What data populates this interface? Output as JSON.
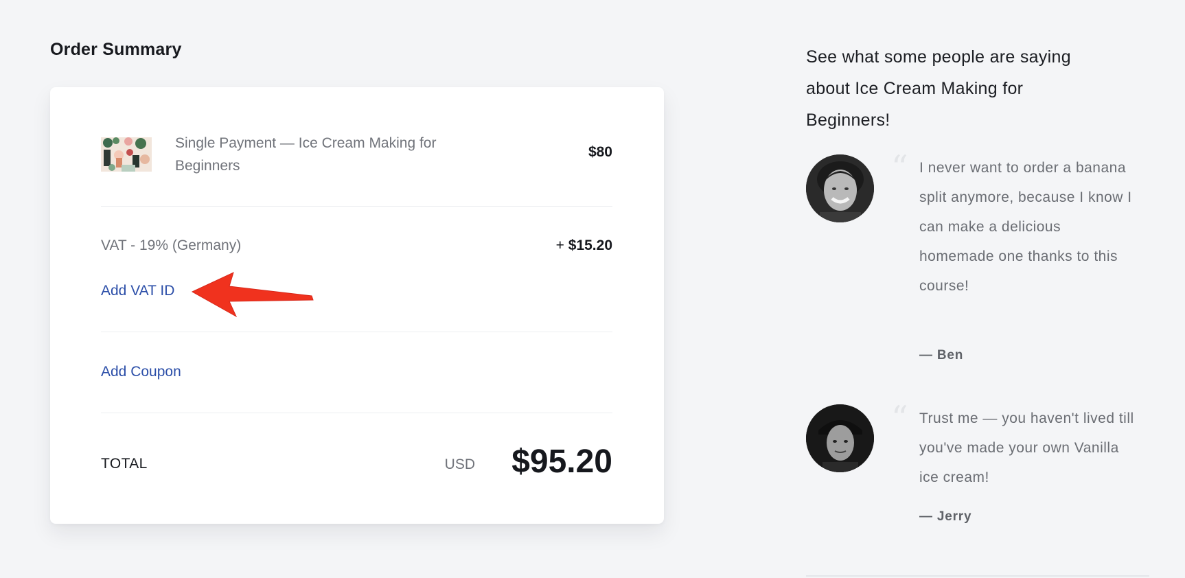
{
  "order_summary": {
    "title": "Order Summary",
    "product": {
      "name": "Single Payment — Ice Cream Making for Beginners",
      "price": "$80",
      "thumbnail_icon": "course-thumbnail-image"
    },
    "vat": {
      "label": "VAT - 19% (Germany)",
      "prefix": "+",
      "amount": "$15.20"
    },
    "add_vat_id_label": "Add VAT ID",
    "add_coupon_label": "Add Coupon",
    "total": {
      "label": "TOTAL",
      "currency": "USD",
      "amount": "$95.20"
    },
    "annotation": {
      "icon": "red-arrow-annotation-icon",
      "color": "#f0321e"
    }
  },
  "testimonials": {
    "heading": "See what some people are saying about Ice Cream Making for Beginners!",
    "items": [
      {
        "quote": "I never want to order a banana split anymore, because I know I can make a delicious homemade one thanks to this course!",
        "author": "— Ben",
        "avatar_icon": "avatar-photo"
      },
      {
        "quote": "Trust me — you haven't lived till you've made your own Vanilla ice cream!",
        "author": "— Jerry",
        "avatar_icon": "avatar-photo"
      }
    ],
    "quote_mark": "“"
  },
  "colors": {
    "link": "#2b4ea8",
    "background": "#f4f5f7",
    "card": "#ffffff"
  }
}
